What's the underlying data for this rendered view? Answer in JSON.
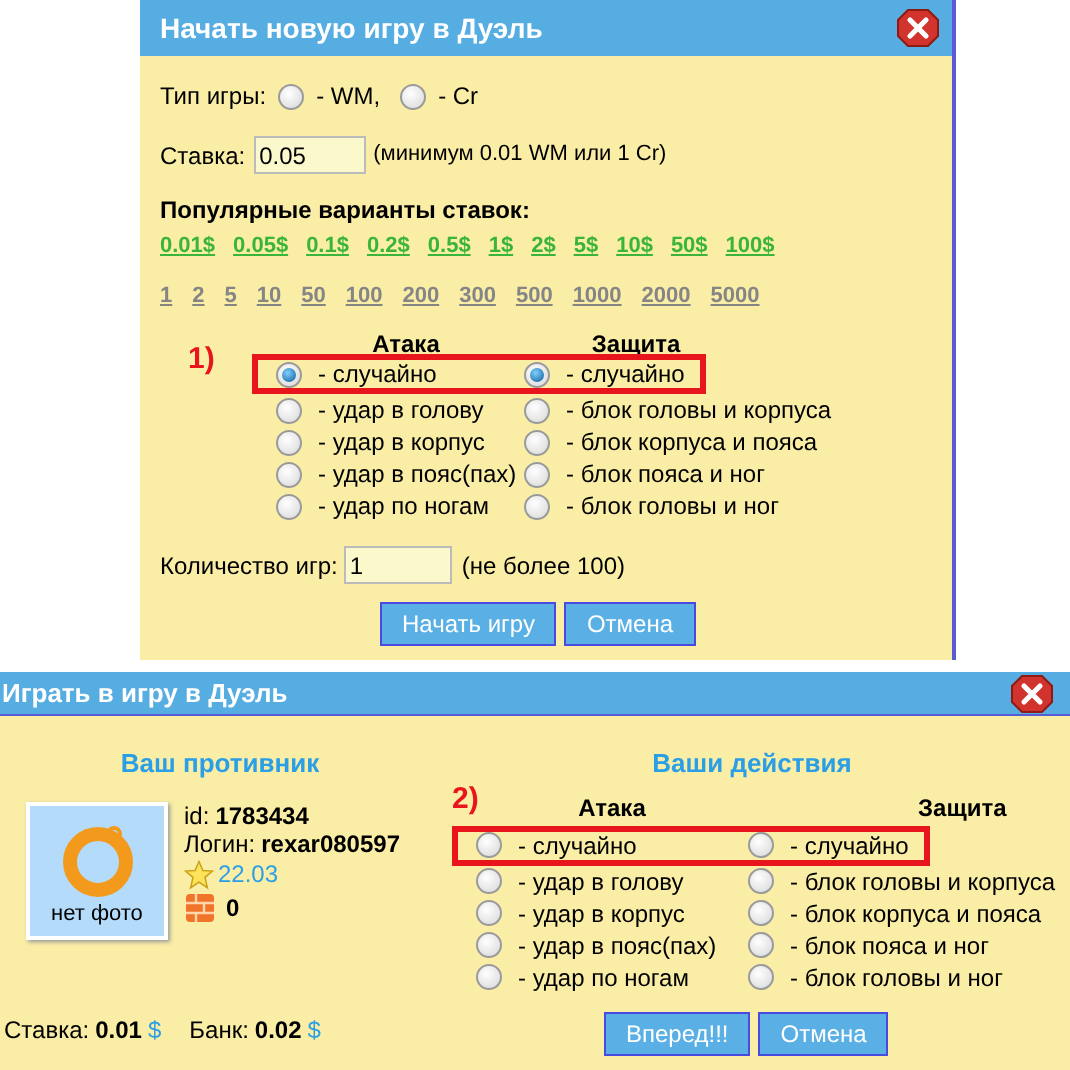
{
  "new_game_dialog": {
    "title": "Начать новую игру в Дуэль",
    "game_type": {
      "label": "Тип игры:",
      "options": [
        {
          "label": "- WM,",
          "selected": false
        },
        {
          "label": "- Cr",
          "selected": false
        }
      ]
    },
    "stake": {
      "label": "Ставка:",
      "value": "0.05",
      "hint": "(минимум 0.01 WM или 1 Cr)"
    },
    "popular": {
      "title": "Популярные варианты ставок:",
      "dollar_links": [
        "0.01$",
        "0.05$",
        "0.1$",
        "0.2$",
        "0.5$",
        "1$",
        "2$",
        "5$",
        "10$",
        "50$",
        "100$"
      ],
      "credit_links": [
        "1",
        "2",
        "5",
        "10",
        "50",
        "100",
        "200",
        "300",
        "500",
        "1000",
        "2000",
        "5000"
      ]
    },
    "step_marker": "1)",
    "attack": {
      "heading": "Атака",
      "options": [
        {
          "label": "- случайно",
          "selected": true
        },
        {
          "label": "- удар в голову",
          "selected": false
        },
        {
          "label": "- удар в корпус",
          "selected": false
        },
        {
          "label": "- удар в пояс(пах)",
          "selected": false
        },
        {
          "label": "- удар по ногам",
          "selected": false
        }
      ]
    },
    "defense": {
      "heading": "Защита",
      "options": [
        {
          "label": "- случайно",
          "selected": true
        },
        {
          "label": "- блок головы и корпуса",
          "selected": false
        },
        {
          "label": "- блок корпуса и пояса",
          "selected": false
        },
        {
          "label": "- блок пояса и ног",
          "selected": false
        },
        {
          "label": "- блок головы и ног",
          "selected": false
        }
      ]
    },
    "count": {
      "label": "Количество игр:",
      "value": "1",
      "hint": "(не более 100)"
    },
    "buttons": [
      "Начать игру",
      "Отмена"
    ]
  },
  "play_dialog": {
    "title": "Играть в игру в Дуэль",
    "opponent": {
      "heading": "Ваш противник",
      "photo_caption": "нет фото",
      "id_label": "id:",
      "id": "1783434",
      "login_label": "Логин:",
      "login": "rexar080597",
      "rating": "22.03",
      "bricks": "0"
    },
    "stake": {
      "label": "Ставка:",
      "value": "0.01",
      "currency": "$"
    },
    "bank": {
      "label": "Банк:",
      "value": "0.02",
      "currency": "$"
    },
    "actions_heading": "Ваши действия",
    "step_marker": "2)",
    "attack": {
      "heading": "Атака",
      "options": [
        {
          "label": "- случайно",
          "selected": false
        },
        {
          "label": "- удар в голову",
          "selected": false
        },
        {
          "label": "- удар в корпус",
          "selected": false
        },
        {
          "label": "- удар в пояс(пах)",
          "selected": false
        },
        {
          "label": "- удар по ногам",
          "selected": false
        }
      ]
    },
    "defense": {
      "heading": "Защита",
      "options": [
        {
          "label": "- случайно",
          "selected": false
        },
        {
          "label": "- блок головы и корпуса",
          "selected": false
        },
        {
          "label": "- блок корпуса и пояса",
          "selected": false
        },
        {
          "label": "- блок пояса и ног",
          "selected": false
        },
        {
          "label": "- блок головы и ног",
          "selected": false
        }
      ]
    },
    "buttons": [
      "Вперед!!!",
      "Отмена"
    ]
  }
}
